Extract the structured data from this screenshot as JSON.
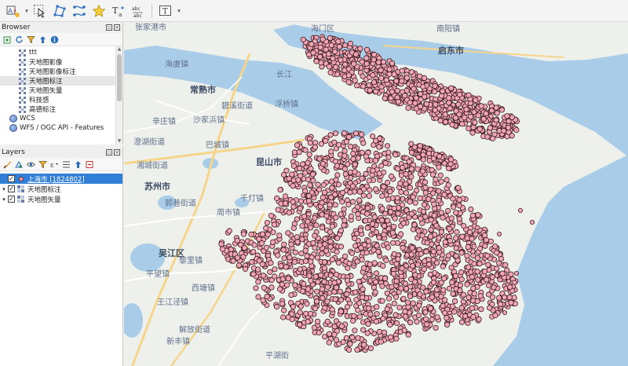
{
  "browser": {
    "title": "Browser",
    "items": [
      {
        "label": "ttt",
        "icon": "raster-layer-icon"
      },
      {
        "label": "天地图影像",
        "icon": "raster-layer-icon"
      },
      {
        "label": "天地图影像标注",
        "icon": "raster-layer-icon"
      },
      {
        "label": "天地图标注",
        "icon": "raster-layer-icon",
        "selected": true
      },
      {
        "label": "天地图矢量",
        "icon": "raster-layer-icon"
      },
      {
        "label": "科技感",
        "icon": "raster-layer-icon"
      },
      {
        "label": "高德标注",
        "icon": "raster-layer-icon"
      },
      {
        "label": "WCS",
        "icon": "globe-icon"
      },
      {
        "label": "WFS / OGC API - Features",
        "icon": "globe-icon"
      }
    ]
  },
  "layers": {
    "title": "Layers",
    "items": [
      {
        "label": "上海市 [1824802]",
        "checked": true,
        "selected": true,
        "type": "point"
      },
      {
        "label": "天地图标注",
        "checked": true,
        "selected": false,
        "type": "raster"
      },
      {
        "label": "天地图矢量",
        "checked": true,
        "selected": false,
        "type": "raster"
      }
    ]
  },
  "map": {
    "labels": {
      "zhangjiagang": "张家港市",
      "haimen": "海门区",
      "nanyang": "南阳镇",
      "qidong": "启东市",
      "changjiang": "长江",
      "haiyu": "海虞镇",
      "changshu": "常熟市",
      "bixi": "碧溪街道",
      "fuqiao": "浮桥镇",
      "xinzhuang": "辛庄镇",
      "shajiabang": "沙家浜镇",
      "chenghu": "澄湖街道",
      "bacheng": "巴城镇",
      "kunshan": "昆山市",
      "xiangcheng": "湘城街道",
      "suzhou": "苏州市",
      "guoxiang": "郭巷街道",
      "qiandeng": "千灯镇",
      "zhoushi": "周市镇",
      "wujiang": "吴江区",
      "lili": "黎里镇",
      "pingwang": "平望镇",
      "xitang": "西塘镇",
      "wangjiangjing": "王江泾镇",
      "jiexing": "解放街道",
      "xinfeng": "新丰镇",
      "pinghu": "平湖街"
    },
    "colors": {
      "land": "#eef0ec",
      "water": "#a9cde8",
      "points_fill": "#f0a6b4",
      "points_stroke": "#3a1a20",
      "road_major": "#f6d58a",
      "road_minor": "#ffffff"
    }
  },
  "toolbar": {
    "icons": [
      "label-tool-icon",
      "select-feature-icon",
      "vertex-tool-icon",
      "node-tool-icon",
      "star-icon",
      "text-tool-icon",
      "label-pin-icon",
      "text-annotation-icon"
    ]
  }
}
